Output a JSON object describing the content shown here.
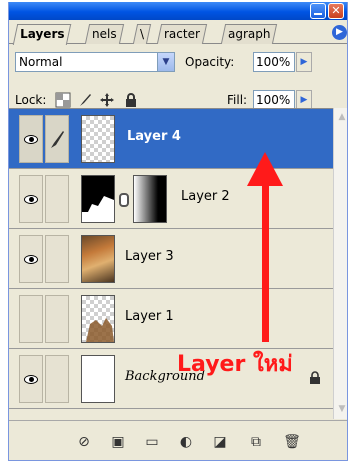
{
  "tabs": [
    {
      "label": "Layers",
      "active": true
    },
    {
      "label": "nels"
    },
    {
      "label": "\\"
    },
    {
      "label": "racter"
    },
    {
      "label": "agraph"
    }
  ],
  "blend": {
    "mode": "Normal",
    "opacity_label": "Opacity:",
    "opacity_value": "100%"
  },
  "lock": {
    "label": "Lock:",
    "fill_label": "Fill:",
    "fill_value": "100%"
  },
  "layers": [
    {
      "name": "Layer 4",
      "visible": true,
      "selected": true,
      "has_mask": false
    },
    {
      "name": "Layer 2",
      "visible": true,
      "selected": false,
      "has_mask": true
    },
    {
      "name": "Layer 3",
      "visible": true,
      "selected": false,
      "has_mask": false
    },
    {
      "name": "Layer 1",
      "visible": false,
      "selected": false,
      "has_mask": false
    },
    {
      "name": "Background",
      "visible": true,
      "selected": false,
      "locked": true
    }
  ],
  "annotation": {
    "text": "Layer ใหม่",
    "color": "#ff1a1a"
  },
  "toolbar_icons": [
    "link-layers-icon",
    "layer-style-icon",
    "mask-icon",
    "new-group-icon",
    "adjustment-layer-icon",
    "new-layer-icon",
    "delete-layer-icon"
  ],
  "colors": {
    "selection": "#316ac5",
    "panel": "#ece9d8",
    "titlebar": "#0054e3"
  }
}
